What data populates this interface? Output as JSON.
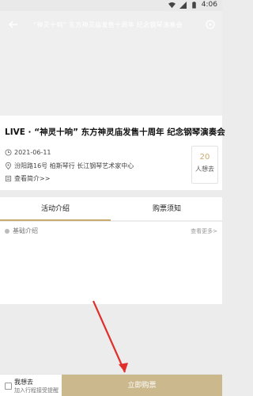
{
  "statusbar": {
    "time": "4:06"
  },
  "header": {
    "title": "“神灵十响” 东方神灵庙发售十周年 纪念钢琴演奏会"
  },
  "event": {
    "title": "LIVE · “神灵十响” 东方神灵庙发售十周年 纪念钢琴演奏会",
    "date": "2021-06-11",
    "address": "汾阳路16号 柏斯琴行 长江钢琴艺术家中心",
    "venue_link": "查看简介>>"
  },
  "want_card": {
    "count": "20",
    "label": "人想去"
  },
  "tabs": [
    {
      "label": "活动介绍"
    },
    {
      "label": "购票须知"
    }
  ],
  "section": {
    "heading": "基础介绍",
    "more": "查看更多>"
  },
  "bottom": {
    "want_line1": "我想去",
    "want_line2": "加入行程接受提醒",
    "buy_label": "立即购票"
  },
  "colors": {
    "accent": "#c9a96e",
    "buy_button": "#cbb88c"
  }
}
